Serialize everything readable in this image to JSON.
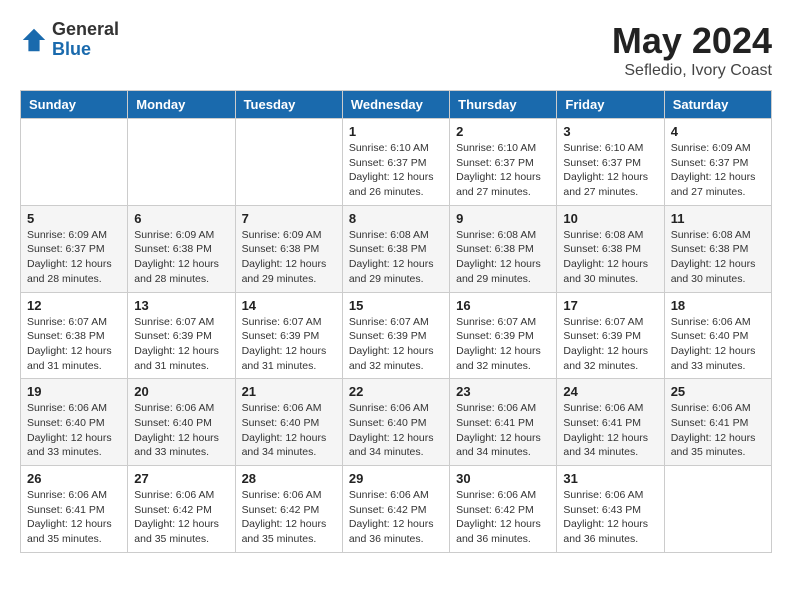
{
  "logo": {
    "general": "General",
    "blue": "Blue"
  },
  "title": "May 2024",
  "subtitle": "Sefledio, Ivory Coast",
  "weekdays": [
    "Sunday",
    "Monday",
    "Tuesday",
    "Wednesday",
    "Thursday",
    "Friday",
    "Saturday"
  ],
  "weeks": [
    [
      {
        "day": "",
        "info": ""
      },
      {
        "day": "",
        "info": ""
      },
      {
        "day": "",
        "info": ""
      },
      {
        "day": "1",
        "info": "Sunrise: 6:10 AM\nSunset: 6:37 PM\nDaylight: 12 hours\nand 26 minutes."
      },
      {
        "day": "2",
        "info": "Sunrise: 6:10 AM\nSunset: 6:37 PM\nDaylight: 12 hours\nand 27 minutes."
      },
      {
        "day": "3",
        "info": "Sunrise: 6:10 AM\nSunset: 6:37 PM\nDaylight: 12 hours\nand 27 minutes."
      },
      {
        "day": "4",
        "info": "Sunrise: 6:09 AM\nSunset: 6:37 PM\nDaylight: 12 hours\nand 27 minutes."
      }
    ],
    [
      {
        "day": "5",
        "info": "Sunrise: 6:09 AM\nSunset: 6:37 PM\nDaylight: 12 hours\nand 28 minutes."
      },
      {
        "day": "6",
        "info": "Sunrise: 6:09 AM\nSunset: 6:38 PM\nDaylight: 12 hours\nand 28 minutes."
      },
      {
        "day": "7",
        "info": "Sunrise: 6:09 AM\nSunset: 6:38 PM\nDaylight: 12 hours\nand 29 minutes."
      },
      {
        "day": "8",
        "info": "Sunrise: 6:08 AM\nSunset: 6:38 PM\nDaylight: 12 hours\nand 29 minutes."
      },
      {
        "day": "9",
        "info": "Sunrise: 6:08 AM\nSunset: 6:38 PM\nDaylight: 12 hours\nand 29 minutes."
      },
      {
        "day": "10",
        "info": "Sunrise: 6:08 AM\nSunset: 6:38 PM\nDaylight: 12 hours\nand 30 minutes."
      },
      {
        "day": "11",
        "info": "Sunrise: 6:08 AM\nSunset: 6:38 PM\nDaylight: 12 hours\nand 30 minutes."
      }
    ],
    [
      {
        "day": "12",
        "info": "Sunrise: 6:07 AM\nSunset: 6:38 PM\nDaylight: 12 hours\nand 31 minutes."
      },
      {
        "day": "13",
        "info": "Sunrise: 6:07 AM\nSunset: 6:39 PM\nDaylight: 12 hours\nand 31 minutes."
      },
      {
        "day": "14",
        "info": "Sunrise: 6:07 AM\nSunset: 6:39 PM\nDaylight: 12 hours\nand 31 minutes."
      },
      {
        "day": "15",
        "info": "Sunrise: 6:07 AM\nSunset: 6:39 PM\nDaylight: 12 hours\nand 32 minutes."
      },
      {
        "day": "16",
        "info": "Sunrise: 6:07 AM\nSunset: 6:39 PM\nDaylight: 12 hours\nand 32 minutes."
      },
      {
        "day": "17",
        "info": "Sunrise: 6:07 AM\nSunset: 6:39 PM\nDaylight: 12 hours\nand 32 minutes."
      },
      {
        "day": "18",
        "info": "Sunrise: 6:06 AM\nSunset: 6:40 PM\nDaylight: 12 hours\nand 33 minutes."
      }
    ],
    [
      {
        "day": "19",
        "info": "Sunrise: 6:06 AM\nSunset: 6:40 PM\nDaylight: 12 hours\nand 33 minutes."
      },
      {
        "day": "20",
        "info": "Sunrise: 6:06 AM\nSunset: 6:40 PM\nDaylight: 12 hours\nand 33 minutes."
      },
      {
        "day": "21",
        "info": "Sunrise: 6:06 AM\nSunset: 6:40 PM\nDaylight: 12 hours\nand 34 minutes."
      },
      {
        "day": "22",
        "info": "Sunrise: 6:06 AM\nSunset: 6:40 PM\nDaylight: 12 hours\nand 34 minutes."
      },
      {
        "day": "23",
        "info": "Sunrise: 6:06 AM\nSunset: 6:41 PM\nDaylight: 12 hours\nand 34 minutes."
      },
      {
        "day": "24",
        "info": "Sunrise: 6:06 AM\nSunset: 6:41 PM\nDaylight: 12 hours\nand 34 minutes."
      },
      {
        "day": "25",
        "info": "Sunrise: 6:06 AM\nSunset: 6:41 PM\nDaylight: 12 hours\nand 35 minutes."
      }
    ],
    [
      {
        "day": "26",
        "info": "Sunrise: 6:06 AM\nSunset: 6:41 PM\nDaylight: 12 hours\nand 35 minutes."
      },
      {
        "day": "27",
        "info": "Sunrise: 6:06 AM\nSunset: 6:42 PM\nDaylight: 12 hours\nand 35 minutes."
      },
      {
        "day": "28",
        "info": "Sunrise: 6:06 AM\nSunset: 6:42 PM\nDaylight: 12 hours\nand 35 minutes."
      },
      {
        "day": "29",
        "info": "Sunrise: 6:06 AM\nSunset: 6:42 PM\nDaylight: 12 hours\nand 36 minutes."
      },
      {
        "day": "30",
        "info": "Sunrise: 6:06 AM\nSunset: 6:42 PM\nDaylight: 12 hours\nand 36 minutes."
      },
      {
        "day": "31",
        "info": "Sunrise: 6:06 AM\nSunset: 6:43 PM\nDaylight: 12 hours\nand 36 minutes."
      },
      {
        "day": "",
        "info": ""
      }
    ]
  ]
}
